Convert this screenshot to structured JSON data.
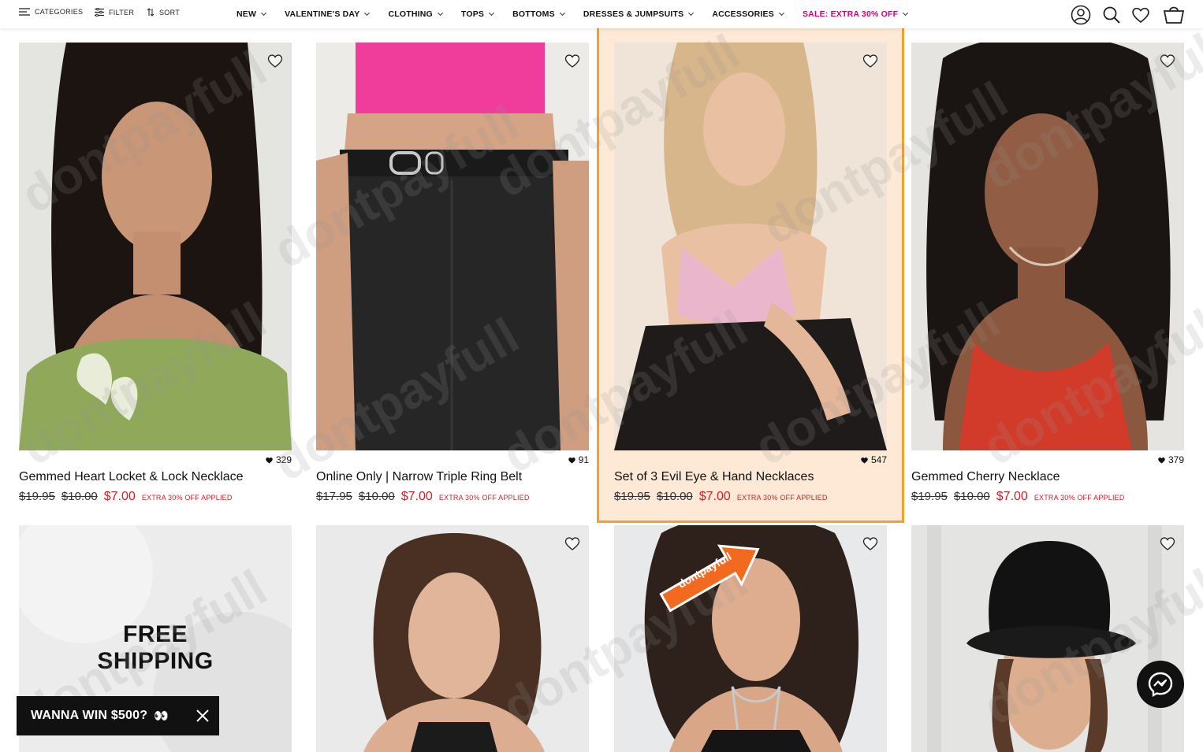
{
  "toolbar": {
    "categories_label": "CATEGORIES",
    "filter_label": "FILTER",
    "sort_label": "SORT"
  },
  "nav": {
    "items": [
      {
        "label": "NEW"
      },
      {
        "label": "VALENTINE'S DAY"
      },
      {
        "label": "CLOTHING"
      },
      {
        "label": "TOPS"
      },
      {
        "label": "BOTTOMS"
      },
      {
        "label": "DRESSES & JUMPSUITS"
      },
      {
        "label": "ACCESSORIES"
      },
      {
        "label": "SALE: EXTRA 30% OFF"
      }
    ],
    "sale_color": "#d6007e"
  },
  "header_icons": [
    "account-icon",
    "search-icon",
    "wishlist-heart-icon",
    "shopping-bag-icon"
  ],
  "products": [
    {
      "name": "Gemmed Heart Locket & Lock Necklace",
      "likes": "329",
      "orig_price": "$19.95",
      "sale_price": "$10.00",
      "final_price": "$7.00",
      "note": "EXTRA 30% OFF APPLIED"
    },
    {
      "name": "Online Only | Narrow Triple Ring Belt",
      "likes": "91",
      "orig_price": "$17.95",
      "sale_price": "$10.00",
      "final_price": "$7.00",
      "note": "EXTRA 30% OFF APPLIED"
    },
    {
      "name": "Set of 3 Evil Eye & Hand Necklaces",
      "likes": "547",
      "orig_price": "$19.95",
      "sale_price": "$10.00",
      "final_price": "$7.00",
      "note": "EXTRA 30% OFF APPLIED"
    },
    {
      "name": "Gemmed Cherry Necklace",
      "likes": "379",
      "orig_price": "$19.95",
      "sale_price": "$10.00",
      "final_price": "$7.00",
      "note": "EXTRA 30% OFF APPLIED"
    }
  ],
  "shipping_banner": {
    "line1": "FREE",
    "line2": "SHIPPING"
  },
  "promo": {
    "text": "WANNA WIN $500?",
    "eyes": "👀"
  },
  "watermark": "dontpayfull",
  "badge": "dontpayfull",
  "colors": {
    "price_red": "#d0202a",
    "highlight_border": "#f2a033",
    "highlight_fill": "#fde9d6"
  }
}
